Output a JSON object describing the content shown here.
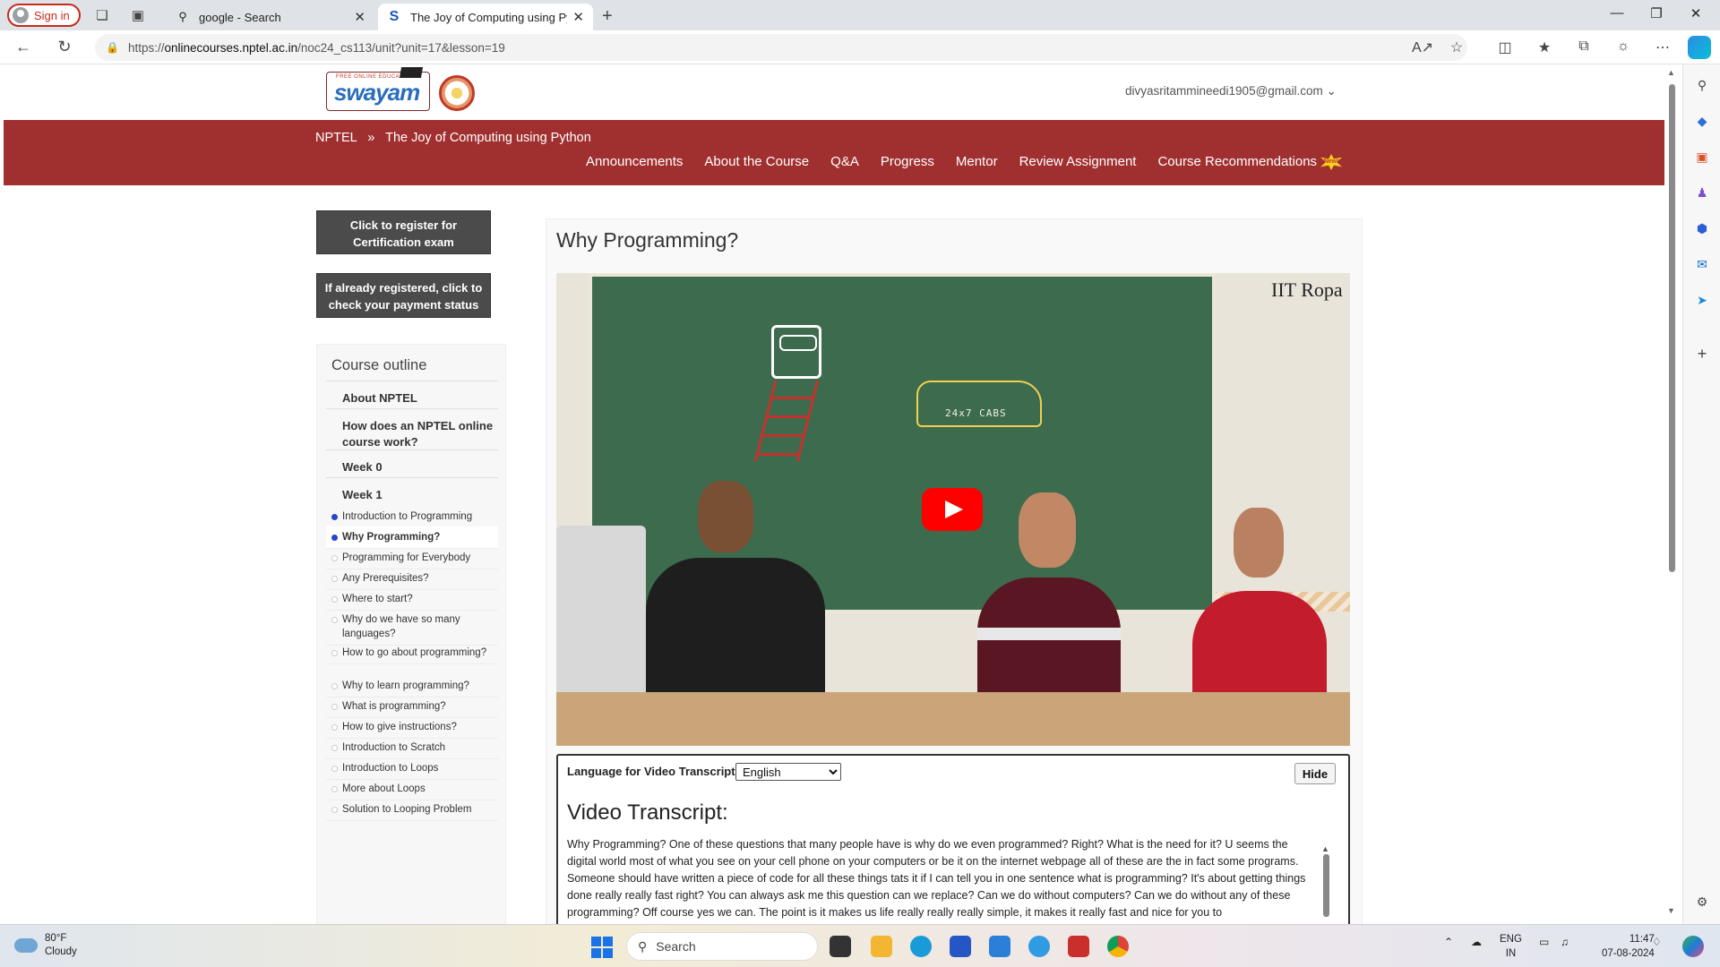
{
  "browser": {
    "signin_label": "Sign in",
    "tabs": [
      {
        "title": "google - Search",
        "active": false
      },
      {
        "title": "The Joy of Computing using Pyth",
        "active": true
      }
    ],
    "url_prefix": "https://",
    "url_host": "onlinecourses.nptel.ac.in",
    "url_path": "/noc24_cs113/unit?unit=17&lesson=19"
  },
  "site": {
    "logo_text": "swayam",
    "logo_tag": "FREE ONLINE EDUCATION",
    "user_email": "divyasritammineedi1905@gmail.com",
    "breadcrumb": {
      "root": "NPTEL",
      "separator": "»",
      "course": "The Joy of Computing using Python"
    },
    "nav": [
      "Announcements",
      "About the Course",
      "Q&A",
      "Progress",
      "Mentor",
      "Review Assignment",
      "Course Recommendations"
    ],
    "new_badge": "New!",
    "brand_color": "#a0302f"
  },
  "sidebar": {
    "register_button": "Click to register for Certification exam",
    "payment_button": "If already registered, click to check your payment status",
    "outline_title": "Course outline",
    "sections": [
      "About NPTEL",
      "How does an NPTEL online course work?",
      "Week 0",
      "Week 1"
    ],
    "lessons": [
      {
        "label": "Introduction to Programming",
        "state": "done"
      },
      {
        "label": "Why Programming?",
        "state": "current"
      },
      {
        "label": "Programming for Everybody",
        "state": "todo"
      },
      {
        "label": "Any Prerequisites?",
        "state": "todo"
      },
      {
        "label": "Where to start?",
        "state": "todo"
      },
      {
        "label": "Why do we have so many languages?",
        "state": "todo"
      },
      {
        "label": "How to go about programming?",
        "state": "todo"
      },
      {
        "label": "Why to learn programming?",
        "state": "todo"
      },
      {
        "label": "What is programming?",
        "state": "todo"
      },
      {
        "label": "How to give instructions?",
        "state": "todo"
      },
      {
        "label": "Introduction to Scratch",
        "state": "todo"
      },
      {
        "label": "Introduction to Loops",
        "state": "todo"
      },
      {
        "label": "More about Loops",
        "state": "todo"
      },
      {
        "label": "Solution to Looping Problem",
        "state": "todo"
      }
    ]
  },
  "main": {
    "lesson_title": "Why Programming?",
    "video": {
      "watermark": "IIT Ropa",
      "board_text": "24x7 CABS"
    },
    "transcript": {
      "language_label": "Language for Video Transcript:",
      "language_value": "English",
      "hide_label": "Hide",
      "title": "Video Transcript:",
      "text": "Why Programming?  One of these questions that many people have is why do we even programmed?  Right?  What is the need for it?  U seems the digital world most of what you see on your cell phone on your computers or  be it on the internet webpage all of these are the in fact some programs.  Someone should have written a piece of code for all these things tats it if I can tell you in one sentence what is programming?  It's about getting things done really really fast right?  You can always ask me this question can we replace?  Can we do without computers?  Can we do without any of these programming?  Off course yes we can.  The point is it makes us life really really really simple, it makes it really fast and nice for you to"
    }
  },
  "taskbar": {
    "weather_temp": "80°F",
    "weather_desc": "Cloudy",
    "search_placeholder": "Search",
    "lang_line1": "ENG",
    "lang_line2": "IN",
    "time": "11:47",
    "date": "07-08-2024"
  }
}
